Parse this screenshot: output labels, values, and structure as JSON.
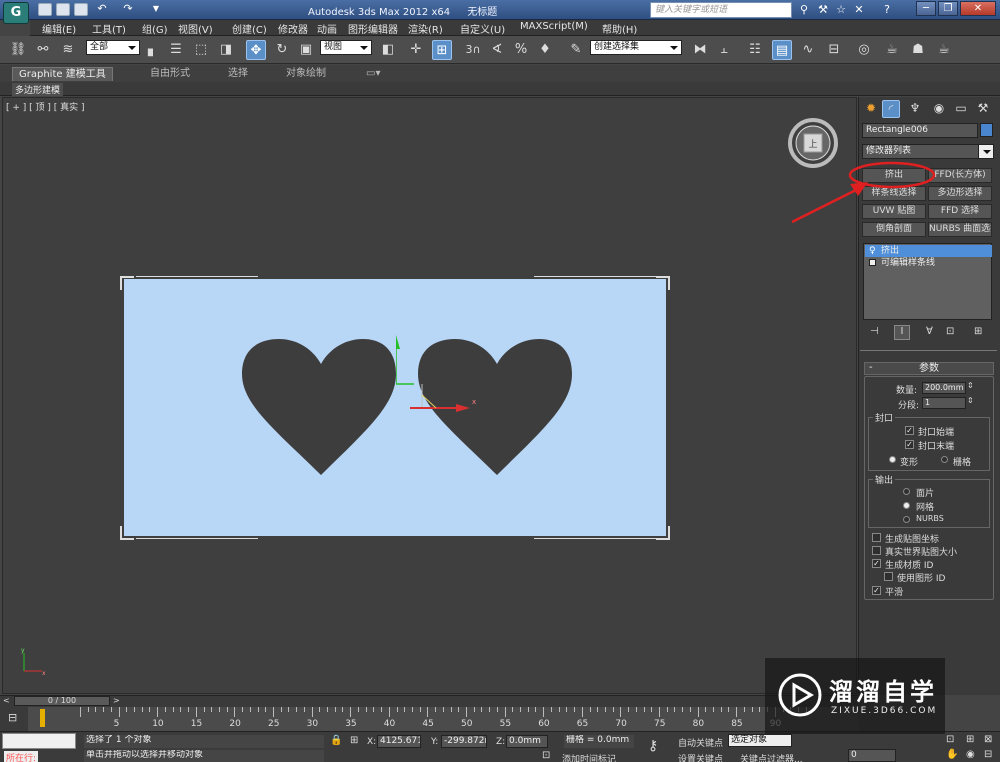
{
  "app": {
    "title": "Autodesk 3ds Max  2012 x64",
    "doc_title": "无标题",
    "search_placeholder": "键入关键字或短语"
  },
  "menubar": {
    "items": [
      "编辑(E)",
      "工具(T)",
      "组(G)",
      "视图(V)",
      "创建(C)",
      "修改器",
      "动画",
      "图形编辑器",
      "渲染(R)",
      "自定义(U)",
      "MAXScript(M)",
      "帮助(H)"
    ]
  },
  "toolbar": {
    "selection_filter": "全部",
    "reference_coord": "视图",
    "snap_value": "3",
    "named_selection": "创建选择集"
  },
  "ribbon": {
    "tabs": [
      "Graphite 建模工具",
      "自由形式",
      "选择",
      "对象绘制"
    ],
    "subtab": "多边形建模"
  },
  "viewport": {
    "label": "[ + ] [ 顶 ] [ 真实 ]",
    "gizmo_x": "x",
    "gizmo_y": "y",
    "plane_color": "#b8d6f6",
    "shape_color": "#3d3d3d"
  },
  "command_panel": {
    "object_name": "Rectangle006",
    "modifier_list": "修改器列表",
    "modifier_buttons": [
      "挤出",
      "FFD(长方体)",
      "样条线选择",
      "多边形选择",
      "UVW 贴图",
      "FFD 选择",
      "倒角剖面",
      "NURBS 曲面选择"
    ],
    "stack": [
      {
        "label": "挤出",
        "selected": true
      },
      {
        "label": "可编辑样条线",
        "selected": false
      }
    ],
    "params": {
      "title": "参数",
      "amount_label": "数量:",
      "amount": "200.0mm",
      "segments_label": "分段:",
      "segments": "1",
      "capping_group": "封口",
      "cap_start": "封口始端",
      "cap_end": "封口末端",
      "morph": "变形",
      "grid": "栅格",
      "output_group": "输出",
      "patch": "面片",
      "mesh": "网格",
      "nurbs": "NURBS",
      "gen_map_coords": "生成贴图坐标",
      "real_world_map": "真实世界贴图大小",
      "gen_mat_ids": "生成材质 ID",
      "use_shape_ids": "使用图形 ID",
      "smooth": "平滑"
    }
  },
  "timeline": {
    "frame_display": "0 / 100",
    "ticks": [
      "0",
      "5",
      "10",
      "15",
      "20",
      "25",
      "30",
      "35",
      "40",
      "45",
      "50",
      "55",
      "60",
      "65",
      "70",
      "75",
      "80",
      "85",
      "90"
    ]
  },
  "status": {
    "running": "所在行:",
    "selected_info": "选择了 1 个对象",
    "prompt": "单击并拖动以选择并移动对象",
    "add_time_tag": "添加时间标记",
    "x_label": "X:",
    "x_value": "4125.671m",
    "y_label": "Y:",
    "y_value": "-299.872m",
    "z_label": "Z:",
    "z_value": "0.0mm",
    "grid": "栅格 = 0.0mm",
    "autokey": "自动关键点",
    "selected_object": "选定对象",
    "set_key": "设置关键点",
    "key_filters": "关键点过滤器...",
    "frame": "0"
  },
  "watermark": {
    "title": "溜溜自学",
    "url": "ZIXUE.3D66.COM"
  },
  "annotation_color": "#e02020"
}
